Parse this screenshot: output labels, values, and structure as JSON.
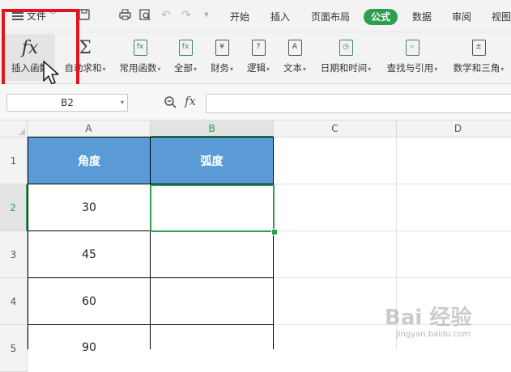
{
  "menubar": {
    "file_label": "文件",
    "tabs": [
      {
        "label": "开始"
      },
      {
        "label": "插入"
      },
      {
        "label": "页面布局"
      },
      {
        "label": "公式",
        "active": true
      },
      {
        "label": "数据"
      },
      {
        "label": "审阅"
      },
      {
        "label": "视图"
      }
    ]
  },
  "ribbon": {
    "insert_function": "插入函数",
    "autosum": "自动求和",
    "common_functions": "常用函数",
    "all": "全部",
    "finance": "财务",
    "logic": "逻辑",
    "text": "文本",
    "datetime": "日期和时间",
    "lookup": "查找与引用",
    "math": "数学和三角",
    "finance_icon_char": "¥",
    "logic_icon_char": "?",
    "text_icon_char": "A"
  },
  "formula_bar": {
    "name_box": "B2",
    "fx_label": "fx",
    "value": ""
  },
  "columns": [
    "A",
    "B",
    "C",
    "D"
  ],
  "rows": [
    "1",
    "2",
    "3",
    "4",
    "5"
  ],
  "table": {
    "headers": [
      "角度",
      "弧度"
    ],
    "values": [
      "30",
      "45",
      "60",
      "90"
    ]
  },
  "watermark": {
    "text": "Bai 经验",
    "url": "jingyan.baidu.com"
  },
  "colors": {
    "accent_green": "#2e9e4f",
    "header_blue": "#5b9bd5",
    "highlight_red": "#e0141e"
  }
}
